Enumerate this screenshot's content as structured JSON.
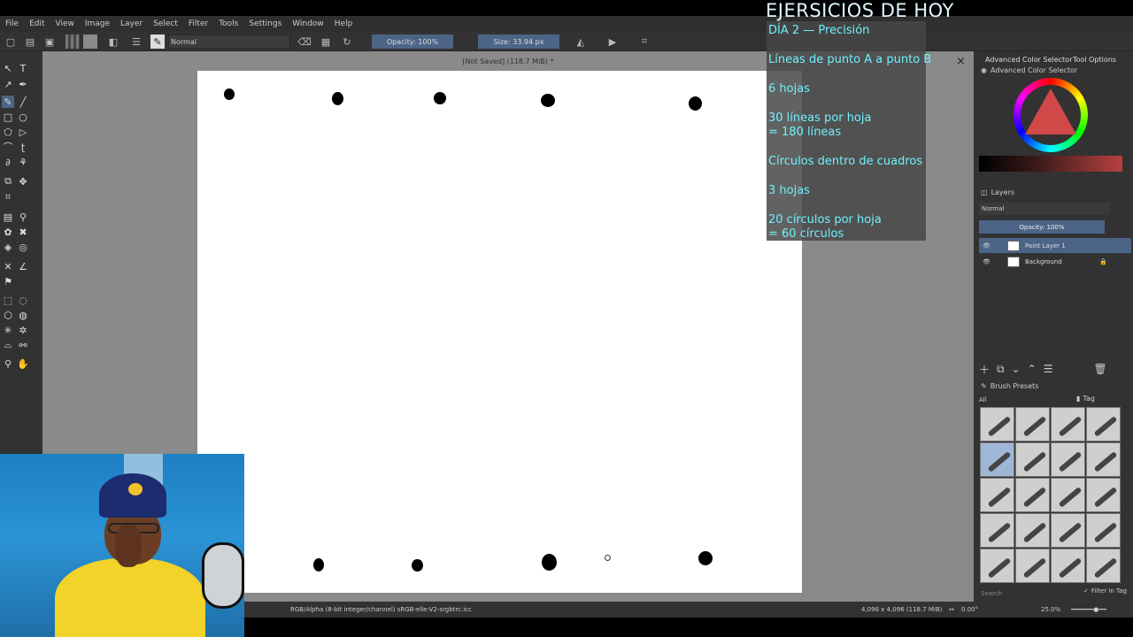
{
  "menu": [
    "File",
    "Edit",
    "View",
    "Image",
    "Layer",
    "Select",
    "Filter",
    "Tools",
    "Settings",
    "Window",
    "Help"
  ],
  "toolbar": {
    "blend_mode": "Normal",
    "opacity": "Opacity: 100%",
    "size": "Size: 33.94 px"
  },
  "document": {
    "tab_title": "[Not Saved]  (118.7 MiB) *",
    "close": "×"
  },
  "dock": {
    "tabs": [
      "Advanced Color Selector",
      "Tool Options"
    ],
    "color_panel_title": "Advanced Color Selector",
    "layers_title": "Layers",
    "layers_blend": "Normal",
    "layers_opacity": "Opacity:  100%",
    "layers": [
      {
        "name": "Paint Layer 1",
        "active": true
      },
      {
        "name": "Background",
        "active": false
      }
    ],
    "brush_title": "Brush Presets",
    "brush_filter": "All",
    "brush_tag": "Tag",
    "search_placeholder": "Search",
    "filter_in_tag": "Filter in Tag"
  },
  "status": {
    "color_profile": "RGB/Alpha (8-bit integer/channel)  sRGB-elle-V2-srgbtrc.icc",
    "image_size": "4,096 x 4,096 (118.7 MiB)",
    "rotation": "0.00°",
    "zoom": "25.0%"
  },
  "overlay": {
    "title": "EJERSICIOS DE HOY",
    "lines": [
      "DÍA 2 — Precisión",
      "Líneas de punto A a punto B",
      "6 hojas",
      "30 líneas por hoja",
      "= 180 líneas",
      "Círculos dentro de cuadros",
      "3 hojas",
      "20 círculos por hoja",
      "= 60 círculos"
    ]
  },
  "colors": {
    "accent": "#4c6486",
    "overlay_text": "#6ff0ff",
    "canvas_bg": "#8a8a8a"
  }
}
